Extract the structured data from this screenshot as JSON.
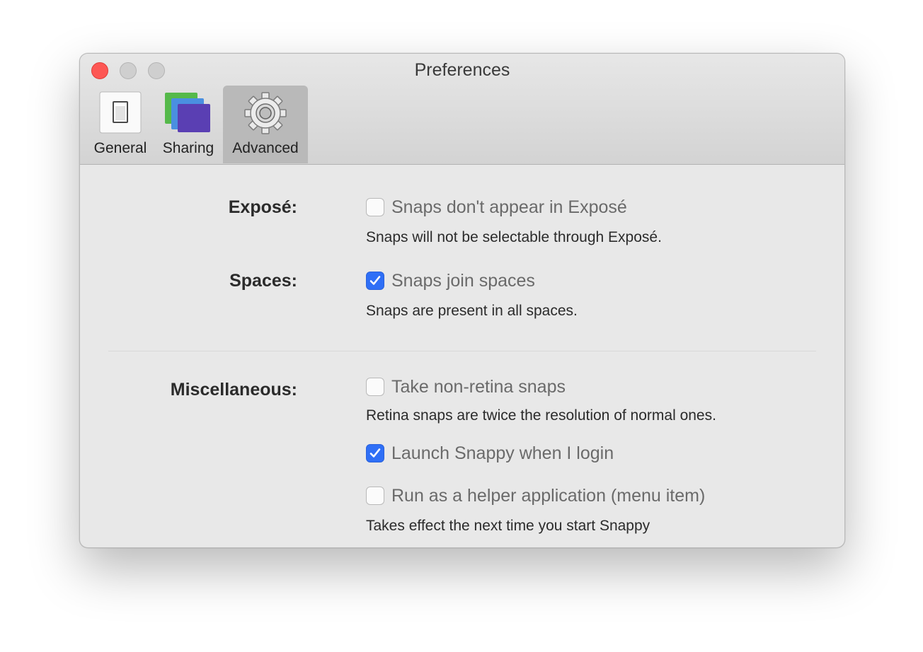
{
  "window": {
    "title": "Preferences"
  },
  "toolbar": {
    "tabs": [
      {
        "label": "General",
        "icon": "general-icon"
      },
      {
        "label": "Sharing",
        "icon": "sharing-icon"
      },
      {
        "label": "Advanced",
        "icon": "gear-icon",
        "selected": true
      }
    ]
  },
  "sections": {
    "expose": {
      "label": "Exposé:",
      "option": {
        "label": "Snaps don't appear in Exposé",
        "checked": false
      },
      "help": "Snaps will not be selectable through Exposé."
    },
    "spaces": {
      "label": "Spaces:",
      "option": {
        "label": "Snaps join spaces",
        "checked": true
      },
      "help": "Snaps are present in all spaces."
    },
    "misc": {
      "label": "Miscellaneous:",
      "options": [
        {
          "label": "Take non-retina snaps",
          "checked": false,
          "help": "Retina snaps are twice the resolution of normal ones."
        },
        {
          "label": "Launch Snappy when I login",
          "checked": true
        },
        {
          "label": "Run as a helper application (menu item)",
          "checked": false,
          "help": "Takes effect the next time you start Snappy"
        }
      ]
    }
  },
  "colors": {
    "accent": "#2f6ff6",
    "close": "#fd5754"
  }
}
